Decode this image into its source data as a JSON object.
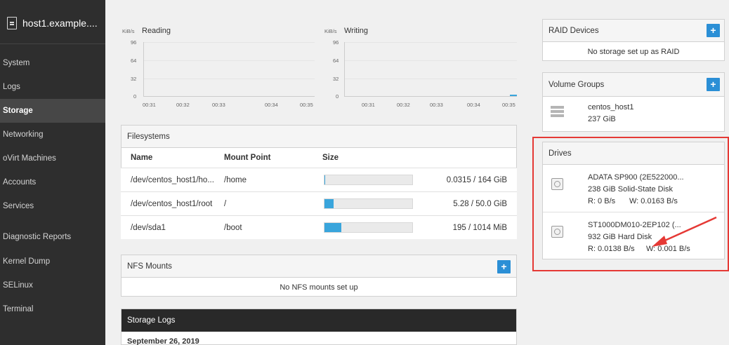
{
  "sidebar": {
    "host": "host1.example....",
    "items": [
      "System",
      "Logs",
      "Storage",
      "Networking",
      "oVirt Machines",
      "Accounts",
      "Services",
      "Diagnostic Reports",
      "Kernel Dump",
      "SELinux",
      "Terminal"
    ],
    "active": "Storage"
  },
  "charts": {
    "reading": {
      "unit": "KiB/s",
      "title": "Reading",
      "yticks": [
        "96",
        "64",
        "32",
        "0"
      ],
      "xticks": [
        "00:31",
        "00:32",
        "00:33",
        "00:34",
        "00:35"
      ]
    },
    "writing": {
      "unit": "KiB/s",
      "title": "Writing",
      "yticks": [
        "96",
        "64",
        "32",
        "0"
      ],
      "xticks": [
        "00:31",
        "00:32",
        "00:33",
        "00:34",
        "00:35"
      ]
    }
  },
  "filesystems": {
    "title": "Filesystems",
    "columns": [
      "Name",
      "Mount Point",
      "Size"
    ],
    "rows": [
      {
        "name": "/dev/centos_host1/ho...",
        "mount": "/home",
        "usage": 0.0002,
        "size": "0.0315 / 164 GiB"
      },
      {
        "name": "/dev/centos_host1/root",
        "mount": "/",
        "usage": 0.106,
        "size": "5.28 / 50.0 GiB"
      },
      {
        "name": "/dev/sda1",
        "mount": "/boot",
        "usage": 0.19,
        "size": "195 / 1014 MiB"
      }
    ]
  },
  "nfs": {
    "title": "NFS Mounts",
    "add": "+",
    "empty": "No NFS mounts set up"
  },
  "logs": {
    "title": "Storage Logs",
    "date": "September 26, 2019"
  },
  "raid": {
    "title": "RAID Devices",
    "add": "+",
    "empty": "No storage set up as RAID"
  },
  "volume_groups": {
    "title": "Volume Groups",
    "add": "+",
    "items": [
      {
        "name": "centos_host1",
        "size": "237 GiB"
      }
    ]
  },
  "drives": {
    "title": "Drives",
    "items": [
      {
        "name": "ADATA SP900 (2E522000...",
        "desc": "238 GiB Solid-State Disk",
        "read": "R: 0 B/s",
        "write": "W: 0.0163 B/s"
      },
      {
        "name": "ST1000DM010-2EP102 (...",
        "desc": "932 GiB Hard Disk",
        "read": "R: 0.0138 B/s",
        "write": "W: 0.001 B/s"
      }
    ]
  },
  "colors": {
    "accent": "#2b8fd6",
    "bar_fill": "#39a5dc",
    "sidebar_bg": "#2e2e2e",
    "highlight": "#e53935",
    "annotation_arrow": "#e53935"
  }
}
